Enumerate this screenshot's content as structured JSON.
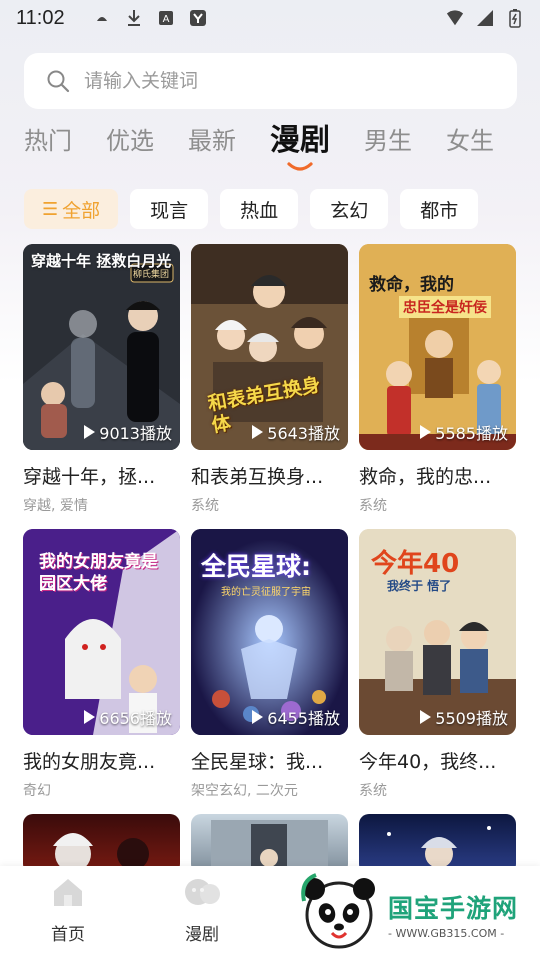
{
  "status_bar": {
    "time": "11:02"
  },
  "search": {
    "placeholder": "请输入关键词"
  },
  "tabs": [
    {
      "label": "热门",
      "active": false
    },
    {
      "label": "优选",
      "active": false
    },
    {
      "label": "最新",
      "active": false
    },
    {
      "label": "漫剧",
      "active": true
    },
    {
      "label": "男生",
      "active": false
    },
    {
      "label": "女生",
      "active": false
    }
  ],
  "filters": [
    {
      "label": "全部",
      "active": true,
      "icon": "list-icon"
    },
    {
      "label": "现言",
      "active": false
    },
    {
      "label": "热血",
      "active": false
    },
    {
      "label": "玄幻",
      "active": false
    },
    {
      "label": "都市",
      "active": false
    }
  ],
  "cards": [
    {
      "title": "穿越十年，拯...",
      "tags": "穿越, 爱情",
      "plays": "9013播放",
      "cover_text": "穿越十年 拯救白月光",
      "cover_sub": "柳氏集团"
    },
    {
      "title": "和表弟互换身...",
      "tags": "系统",
      "plays": "5643播放",
      "cover_text": "和表弟互换身体",
      "cover_sub": ""
    },
    {
      "title": "救命，我的忠...",
      "tags": "系统",
      "plays": "5585播放",
      "cover_text": "救命，我的",
      "cover_sub": "忠臣全是奸佞"
    },
    {
      "title": "我的女朋友竟...",
      "tags": "奇幻",
      "plays": "6656播放",
      "cover_text": "我的女朋友竟是园区大佬",
      "cover_sub": ""
    },
    {
      "title": "全民星球：我...",
      "tags": "架空玄幻, 二次元",
      "plays": "6455播放",
      "cover_text": "全民星球:",
      "cover_sub": "我的亡灵征服了宇宙"
    },
    {
      "title": "今年40，我终...",
      "tags": "系统",
      "plays": "5509播放",
      "cover_text": "今年40",
      "cover_sub": "我终于 悟了"
    }
  ],
  "bottom_nav": [
    {
      "label": "首页",
      "icon": "home-icon"
    },
    {
      "label": "漫剧",
      "icon": "drama-icon"
    }
  ],
  "watermark": {
    "main": "国宝手游网",
    "sub": "- WWW.GB315.COM -"
  },
  "colors": {
    "accent": "#f0a230",
    "active_chip_bg": "#fbeede",
    "tab_inactive": "#8e8e8e"
  }
}
